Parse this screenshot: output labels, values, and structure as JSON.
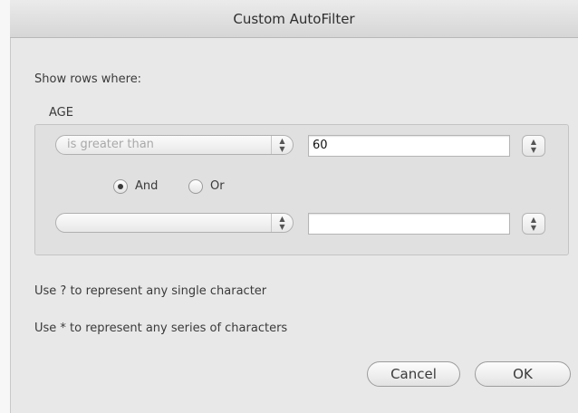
{
  "dialog": {
    "title": "Custom AutoFilter",
    "show_rows_label": "Show rows where:",
    "field_name": "AGE",
    "condition1": {
      "operator": "is greater than",
      "value": "60"
    },
    "logic": {
      "and_label": "And",
      "or_label": "Or",
      "selected": "And"
    },
    "condition2": {
      "operator": "",
      "value": ""
    },
    "hint1": "Use ? to represent any single character",
    "hint2": "Use * to represent any series of characters",
    "cancel_label": "Cancel",
    "ok_label": "OK"
  },
  "icons": {
    "popup_arrows": "up-down-chevron-icon",
    "stepper_arrows": "up-down-chevron-icon",
    "radio_selected": "radio-selected-icon",
    "radio_unselected": "radio-unselected-icon"
  }
}
